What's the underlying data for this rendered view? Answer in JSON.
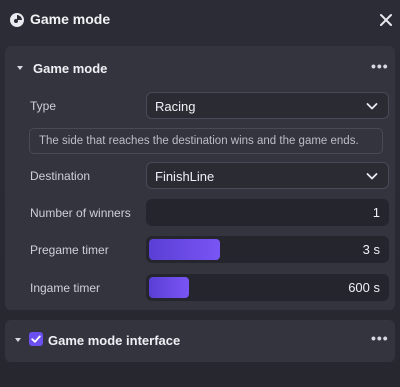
{
  "window": {
    "title": "Game mode"
  },
  "section1": {
    "title": "Game mode",
    "more": "•••",
    "type": {
      "label": "Type",
      "value": "Racing"
    },
    "description": "The side that reaches the destination wins and the game ends.",
    "destination": {
      "label": "Destination",
      "value": "FinishLine"
    },
    "winners": {
      "label": "Number of winners",
      "value": "1"
    },
    "pregame": {
      "label": "Pregame timer",
      "value": "3 s",
      "fill_fraction": 0.3
    },
    "ingame": {
      "label": "Ingame timer",
      "value": "600 s",
      "fill_fraction": 0.17
    }
  },
  "section2": {
    "title": "Game mode interface",
    "more": "•••",
    "checked": true
  },
  "colors": {
    "accent": "#6b4ff0",
    "panel": "#34343f",
    "background": "#2a2a34"
  },
  "icons": {
    "app": "app-logo-icon",
    "close": "close-icon",
    "caret": "caret-down-icon",
    "chevron": "chevron-down-icon",
    "check": "check-icon"
  }
}
